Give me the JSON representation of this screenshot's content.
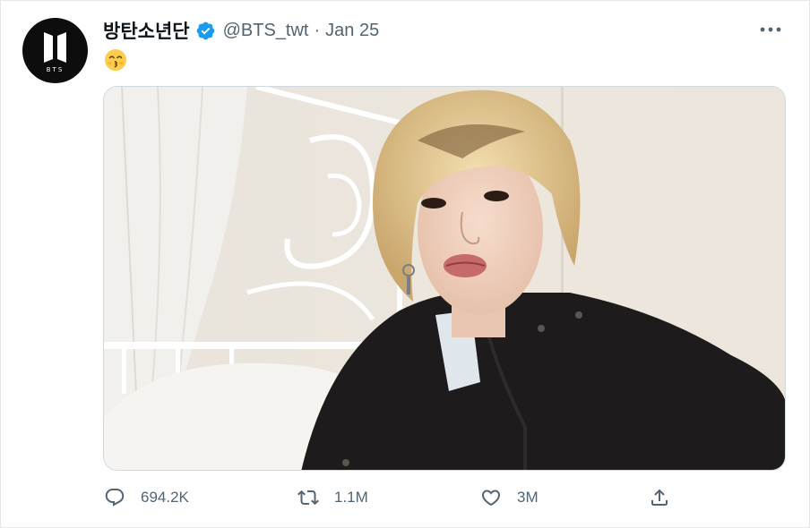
{
  "tweet": {
    "display_name": "방탄소년단",
    "verified": true,
    "handle": "@BTS_twt",
    "separator": "·",
    "date": "Jan 25",
    "text_emoji": "kissing-face-with-smiling-eyes",
    "avatar_text": "BTS",
    "media": {
      "description_icon": "photo"
    },
    "actions": {
      "reply_count": "694.2K",
      "retweet_count": "1.1M",
      "like_count": "3M"
    }
  },
  "colors": {
    "text_primary": "#0f1419",
    "text_secondary": "#536471",
    "verified_blue": "#1d9bf0",
    "avatar_bg": "#0d0d0d"
  }
}
